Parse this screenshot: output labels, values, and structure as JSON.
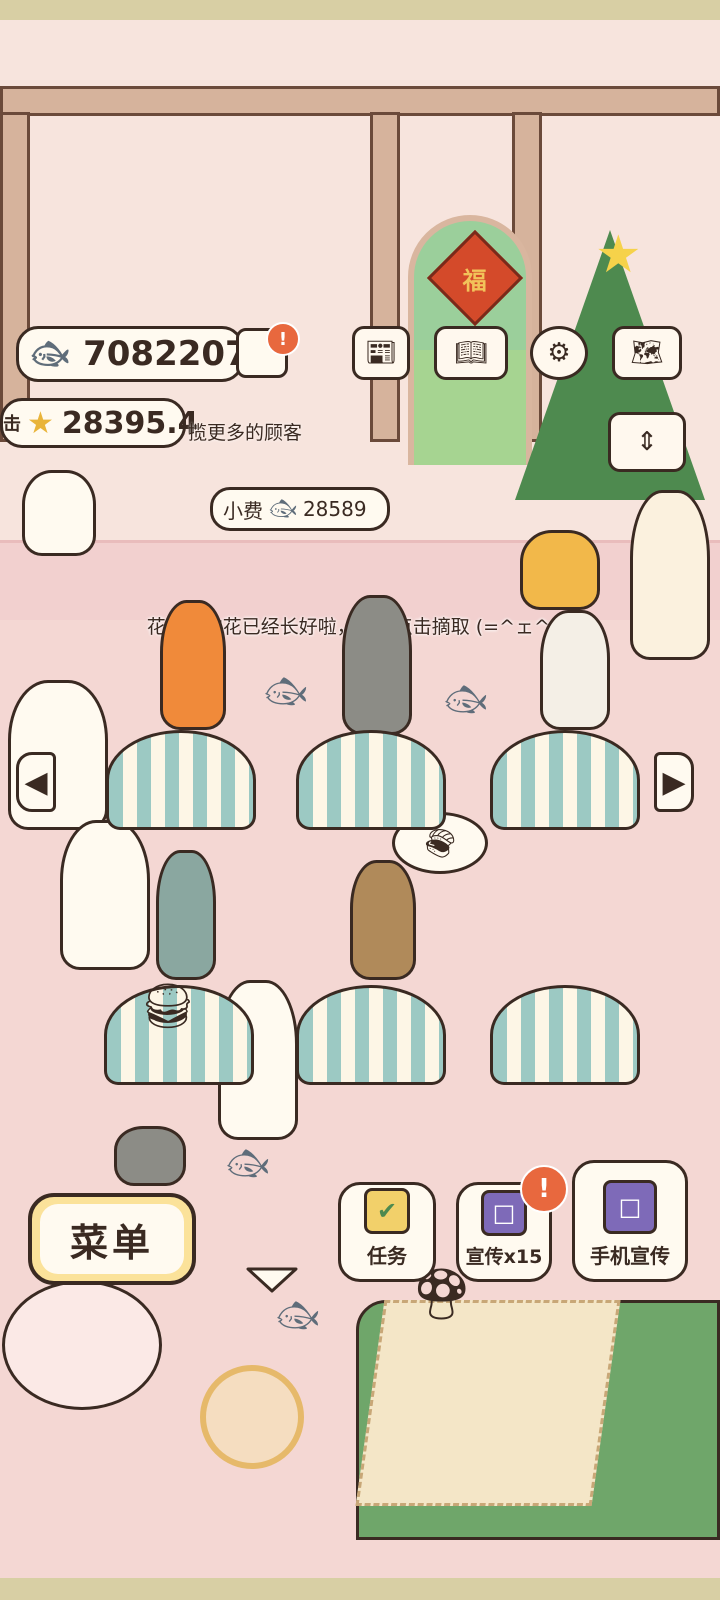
{
  "hud": {
    "fish_count": "7082207",
    "star_count": "28395.4",
    "fish_icon": "fish-icon",
    "star_icon": "star-icon",
    "alert_badge": "!"
  },
  "messages": {
    "partial_left_char": "击",
    "partial_attract": "揽更多的顾客",
    "tip_label": "小费",
    "tip_amount": "28589",
    "notice": "花圃种的花已经长好啦，记得点击摘取 (=^ェ^=)"
  },
  "top_icons": [
    "newspaper-icon",
    "book-paw-icon",
    "settings-gear-icon",
    "map-icon",
    "sort-toggle-icon"
  ],
  "buttons": {
    "menu": "菜单",
    "task": "任务",
    "promo": "宣传x15",
    "phone_promo": "手机宣传",
    "promo_badge": "!"
  },
  "decor": {
    "window_sign": "福",
    "star_glyph": "★",
    "left_arrow": "◀",
    "right_arrow": "▶",
    "down_arrow": "▼"
  },
  "colors": {
    "background": "#f6dcd6",
    "accent_yellow": "#fbe29a",
    "outline": "#3a2a22",
    "badge_orange": "#e8683e",
    "table_stripe": "#9cc9c3"
  }
}
